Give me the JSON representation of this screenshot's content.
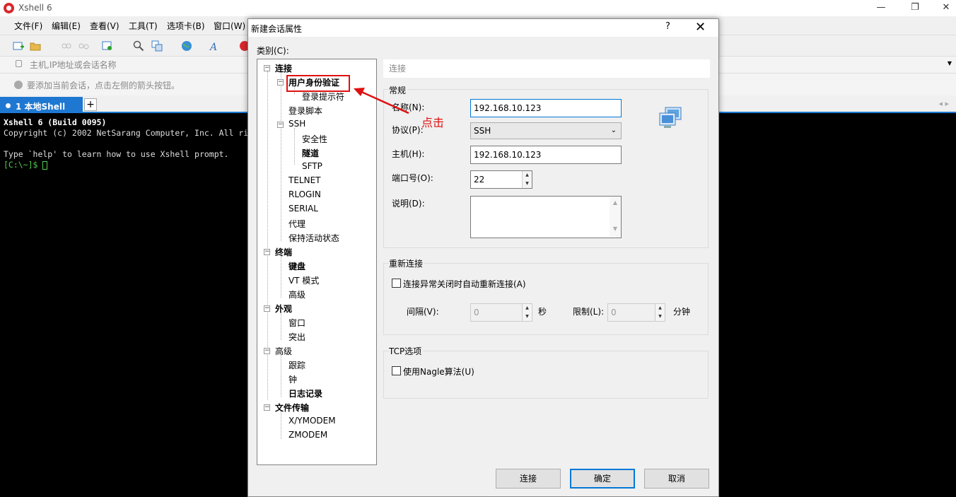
{
  "app": {
    "title": "Xshell 6",
    "window_controls": {
      "minimize": "—",
      "maximize": "❐",
      "close": "✕"
    }
  },
  "menu": [
    "文件(F)",
    "编辑(E)",
    "查看(V)",
    "工具(T)",
    "选项卡(B)",
    "窗口(W)"
  ],
  "address_bar": {
    "placeholder": "主机,IP地址或会话名称"
  },
  "hint_bar": {
    "text": "要添加当前会话，点击左侧的箭头按钮。"
  },
  "tabs": {
    "active_label": "1 本地Shell",
    "add": "+",
    "nav": "◂ ▸"
  },
  "terminal": {
    "line1": "Xshell 6 (Build 0095)",
    "line2": "Copyright (c) 2002 NetSarang Computer, Inc. All ri",
    "line3": "Type `help' to learn how to use Xshell prompt.",
    "prompt": "[C:\\~]$ "
  },
  "dialog": {
    "title": "新建会话属性",
    "help": "?",
    "close": "✕",
    "category_label": "类别(C):",
    "tree": [
      {
        "label": "连接",
        "bold": true
      },
      {
        "label": "用户身份验证",
        "bold": true
      },
      {
        "label": "登录提示符",
        "bold": false
      },
      {
        "label": "登录脚本",
        "bold": false
      },
      {
        "label": "SSH",
        "bold": false
      },
      {
        "label": "安全性",
        "bold": false
      },
      {
        "label": "隧道",
        "bold": true
      },
      {
        "label": "SFTP",
        "bold": false
      },
      {
        "label": "TELNET",
        "bold": false
      },
      {
        "label": "RLOGIN",
        "bold": false
      },
      {
        "label": "SERIAL",
        "bold": false
      },
      {
        "label": "代理",
        "bold": false
      },
      {
        "label": "保持活动状态",
        "bold": false
      },
      {
        "label": "终端",
        "bold": true
      },
      {
        "label": "键盘",
        "bold": true
      },
      {
        "label": "VT 模式",
        "bold": false
      },
      {
        "label": "高级",
        "bold": false
      },
      {
        "label": "外观",
        "bold": true
      },
      {
        "label": "窗口",
        "bold": false
      },
      {
        "label": "突出",
        "bold": false
      },
      {
        "label": "高级",
        "bold": false
      },
      {
        "label": "跟踪",
        "bold": false
      },
      {
        "label": "钟",
        "bold": false
      },
      {
        "label": "日志记录",
        "bold": true
      },
      {
        "label": "文件传输",
        "bold": true
      },
      {
        "label": "X/YMODEM",
        "bold": false
      },
      {
        "label": "ZMODEM",
        "bold": false
      }
    ],
    "panel_header": "连接",
    "general": {
      "group_label": "常规",
      "name_label": "名称(N):",
      "name_value": "192.168.10.123",
      "protocol_label": "协议(P):",
      "protocol_value": "SSH",
      "host_label": "主机(H):",
      "host_value": "192.168.10.123",
      "port_label": "端口号(O):",
      "port_value": "22",
      "desc_label": "说明(D):",
      "desc_value": ""
    },
    "reconnect": {
      "group_label": "重新连接",
      "auto_label": "连接异常关闭时自动重新连接(A)",
      "auto_checked": false,
      "interval_label": "间隔(V):",
      "interval_value": "0",
      "interval_unit": "秒",
      "limit_label": "限制(L):",
      "limit_value": "0",
      "limit_unit": "分钟"
    },
    "tcp": {
      "group_label": "TCP选项",
      "nagle_label": "使用Nagle算法(U)",
      "nagle_checked": false
    },
    "buttons": {
      "connect": "连接",
      "ok": "确定",
      "cancel": "取消"
    }
  },
  "annotation": {
    "text": "点击",
    "color": "#e01010"
  },
  "colors": {
    "accent": "#1e78d2",
    "annotation": "#e01010",
    "terminal_bg": "#000000"
  }
}
